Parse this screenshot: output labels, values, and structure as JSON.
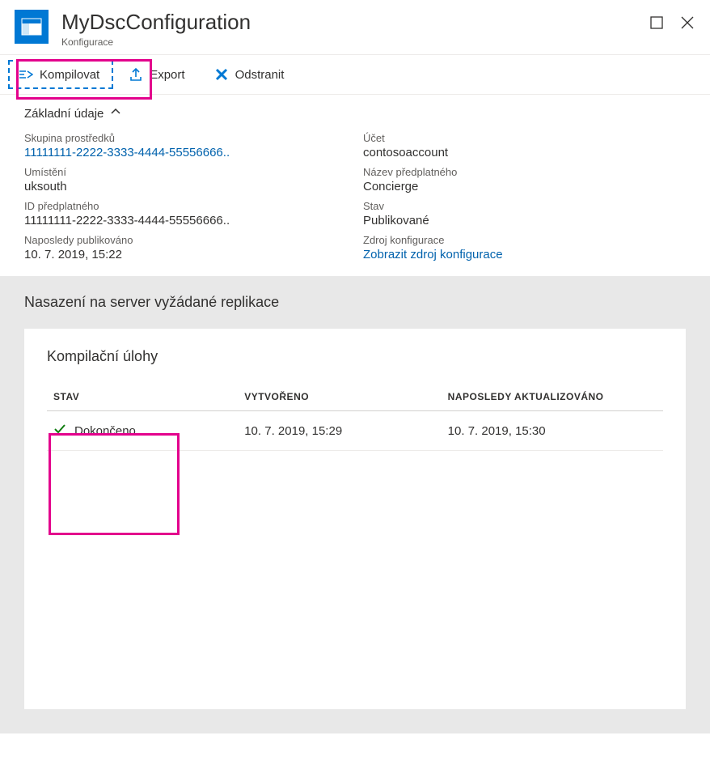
{
  "header": {
    "title": "MyDscConfiguration",
    "subtitle": "Konfigurace"
  },
  "toolbar": {
    "compile": "Kompilovat",
    "export": "Export",
    "delete": "Odstranit"
  },
  "essentials_toggle": "Základní údaje",
  "essentials": {
    "resource_group_label": "Skupina prostředků",
    "resource_group_value": "11111111-2222-3333-4444-55556666..",
    "location_label": "Umístění",
    "location_value": "uksouth",
    "subscription_id_label": "ID předplatného",
    "subscription_id_value": "11111111-2222-3333-4444-55556666..",
    "last_published_label": "Naposledy publikováno",
    "last_published_value": "10. 7. 2019, 15:22",
    "account_label": "Účet",
    "account_value": "contosoaccount",
    "subscription_name_label": "Název předplatného",
    "subscription_name_value": "Concierge",
    "state_label": "Stav",
    "state_value": "Publikované",
    "config_source_label": "Zdroj konfigurace",
    "config_source_value": "Zobrazit zdroj konfigurace"
  },
  "deploy": {
    "section_title": "Nasazení na server vyžádané replikace",
    "card_title": "Kompilační úlohy",
    "columns": {
      "status": "STAV",
      "created": "VYTVOŘENO",
      "updated": "NAPOSLEDY AKTUALIZOVÁNO"
    },
    "rows": [
      {
        "status": "Dokončeno",
        "created": "10. 7. 2019, 15:29",
        "updated": "10. 7. 2019, 15:30"
      }
    ]
  }
}
